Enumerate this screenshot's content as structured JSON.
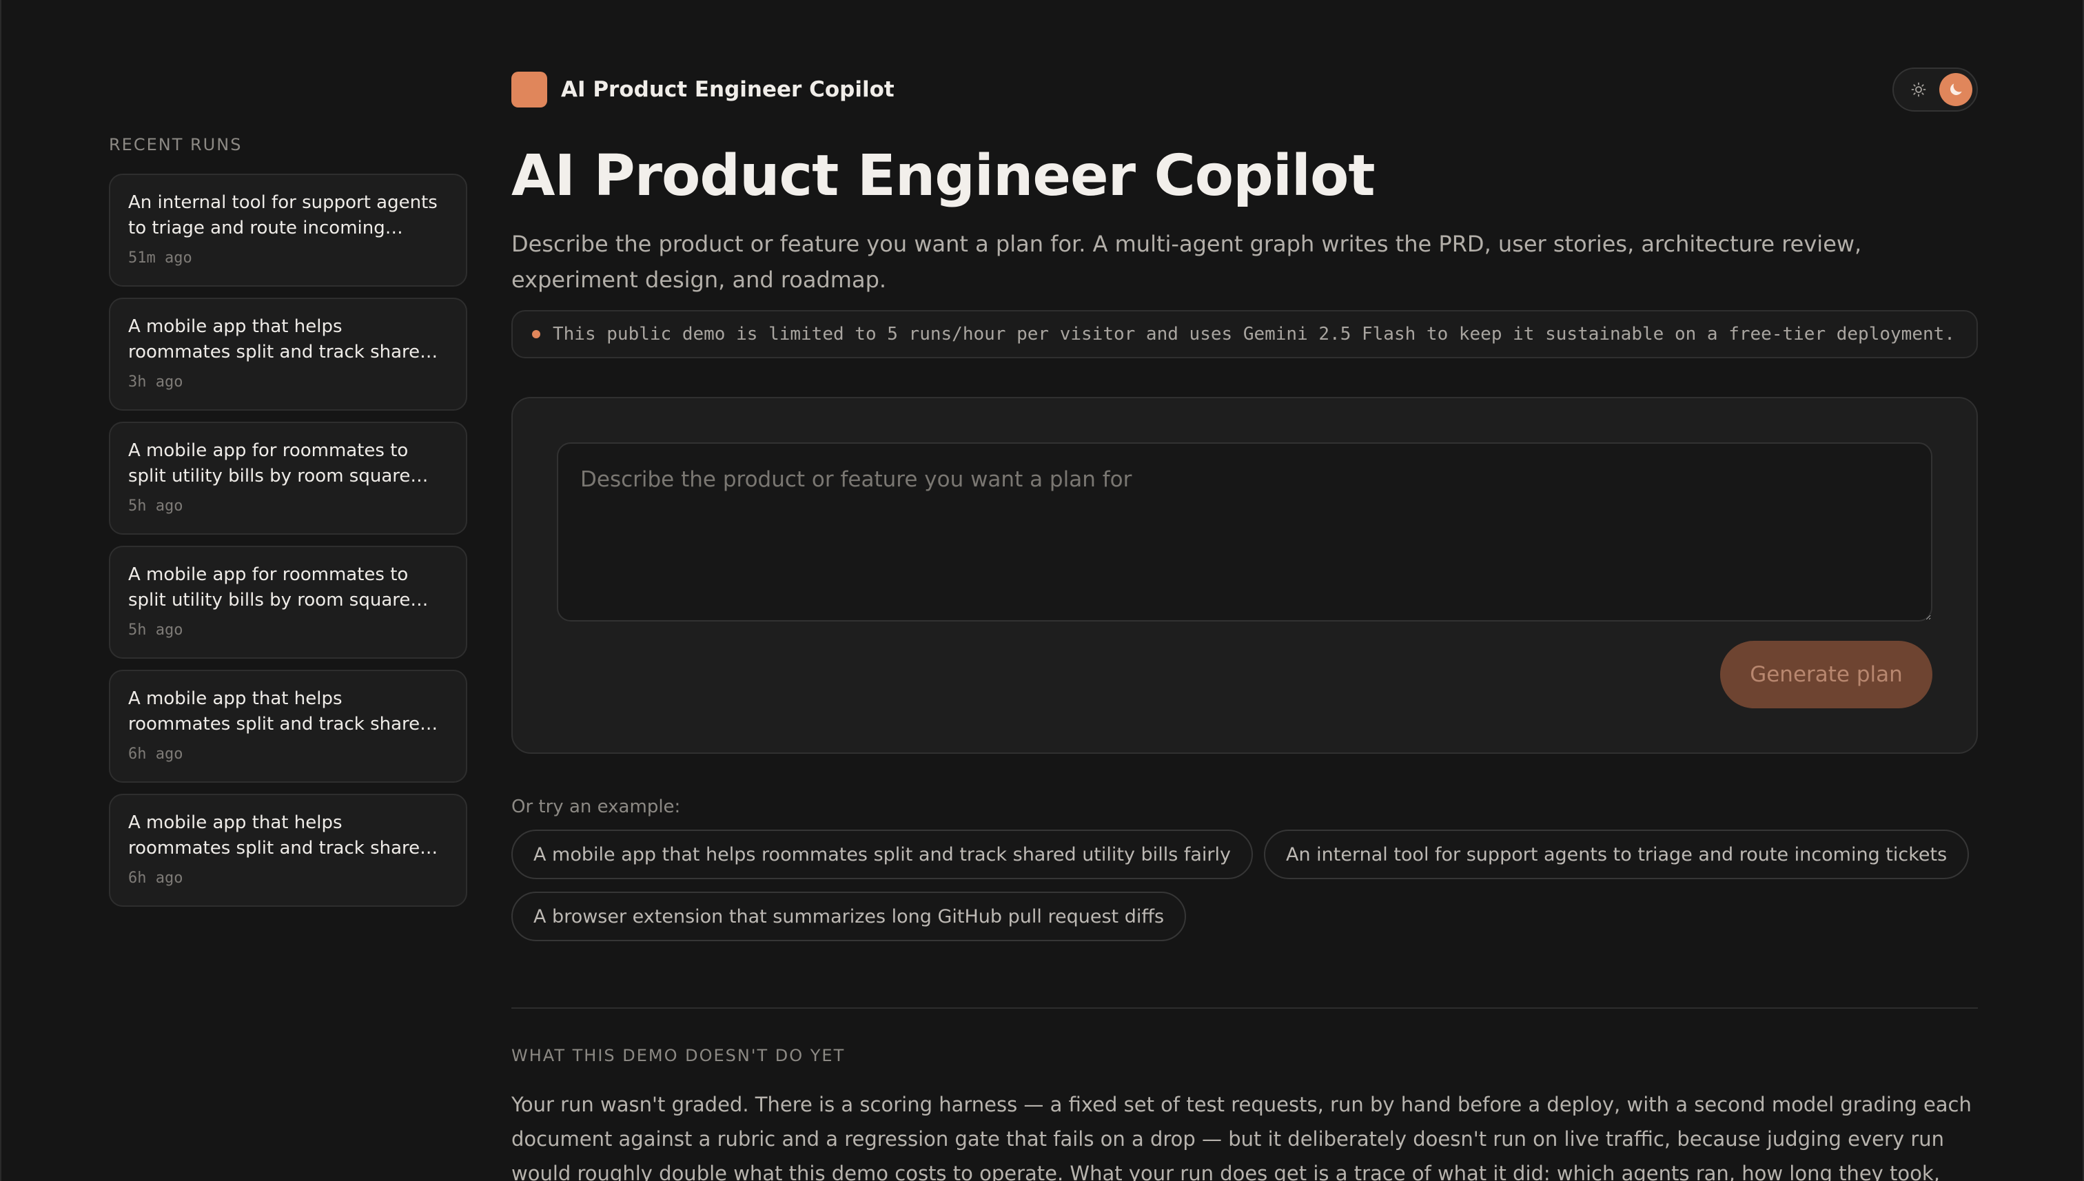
{
  "app": {
    "name": "AI Product Engineer Copilot"
  },
  "theme": {
    "options": [
      "light",
      "dark"
    ],
    "selected": "dark",
    "accent": "#e0865b"
  },
  "sidebar": {
    "heading": "RECENT RUNS",
    "runs": [
      {
        "title": "An internal tool for support agents to triage and route incoming tickets",
        "time": "51m ago"
      },
      {
        "title": "A mobile app that helps roommates split and track shared utility bills fairly",
        "time": "3h ago"
      },
      {
        "title": "A mobile app for roommates to split utility bills by room square footage,...",
        "time": "5h ago"
      },
      {
        "title": "A mobile app for roommates to split utility bills by room square footage,...",
        "time": "5h ago"
      },
      {
        "title": "A mobile app that helps roommates split and track shared utility bills fairly",
        "time": "6h ago"
      },
      {
        "title": "A mobile app that helps roommates split and track shared utility bills fairly",
        "time": "6h ago"
      }
    ]
  },
  "main": {
    "title": "AI Product Engineer Copilot",
    "description": "Describe the product or feature you want a plan for. A multi-agent graph writes the PRD, user stories, architecture review, experiment design, and roadmap.",
    "notice": "This public demo is limited to 5 runs/hour per visitor and uses Gemini 2.5 Flash to keep it sustainable on a free-tier deployment.",
    "prompt": {
      "value": "",
      "placeholder": "Describe the product or feature you want a plan for"
    },
    "generate_label": "Generate plan",
    "examples_label": "Or try an example:",
    "examples": [
      "A mobile app that helps roommates split and track shared utility bills fairly",
      "An internal tool for support agents to triage and route incoming tickets",
      "A browser extension that summarizes long GitHub pull request diffs"
    ],
    "limitations": {
      "heading": "WHAT THIS DEMO DOESN'T DO YET",
      "body": "Your run wasn't graded. There is a scoring harness — a fixed set of test requests, run by hand before a deploy, with a second model grading each document against a rubric and a regression gate that fails on a drop — but it deliberately doesn't run on live traffic, because judging every run would roughly double what this demo costs to operate. What your run does get is a trace of what it did: which agents ran, how long they took, what they cost."
    }
  }
}
